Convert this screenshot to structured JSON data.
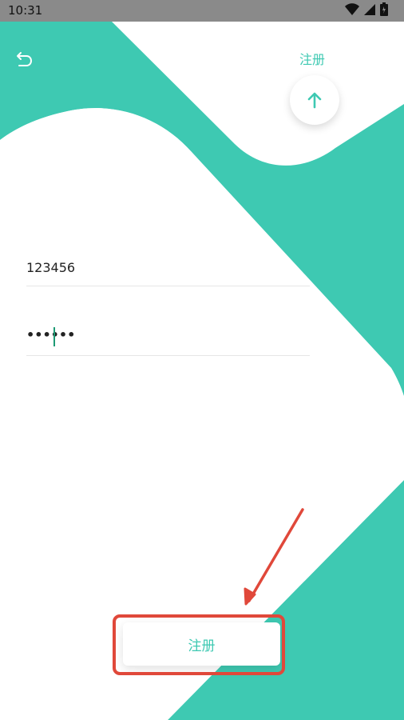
{
  "status_bar": {
    "time": "10:31",
    "icons": [
      "wifi-icon",
      "cell-signal-icon",
      "battery-icon"
    ]
  },
  "header": {
    "title": "注册",
    "back_icon": "undo-arrow-icon",
    "up_icon": "arrow-up-icon"
  },
  "form": {
    "username_value": "123456",
    "password_value": "••••••"
  },
  "register_button": {
    "label": "注册"
  },
  "colors": {
    "accent": "#3ec9b2",
    "annotation": "#e0483a",
    "status_bar": "#8a8a8a"
  }
}
